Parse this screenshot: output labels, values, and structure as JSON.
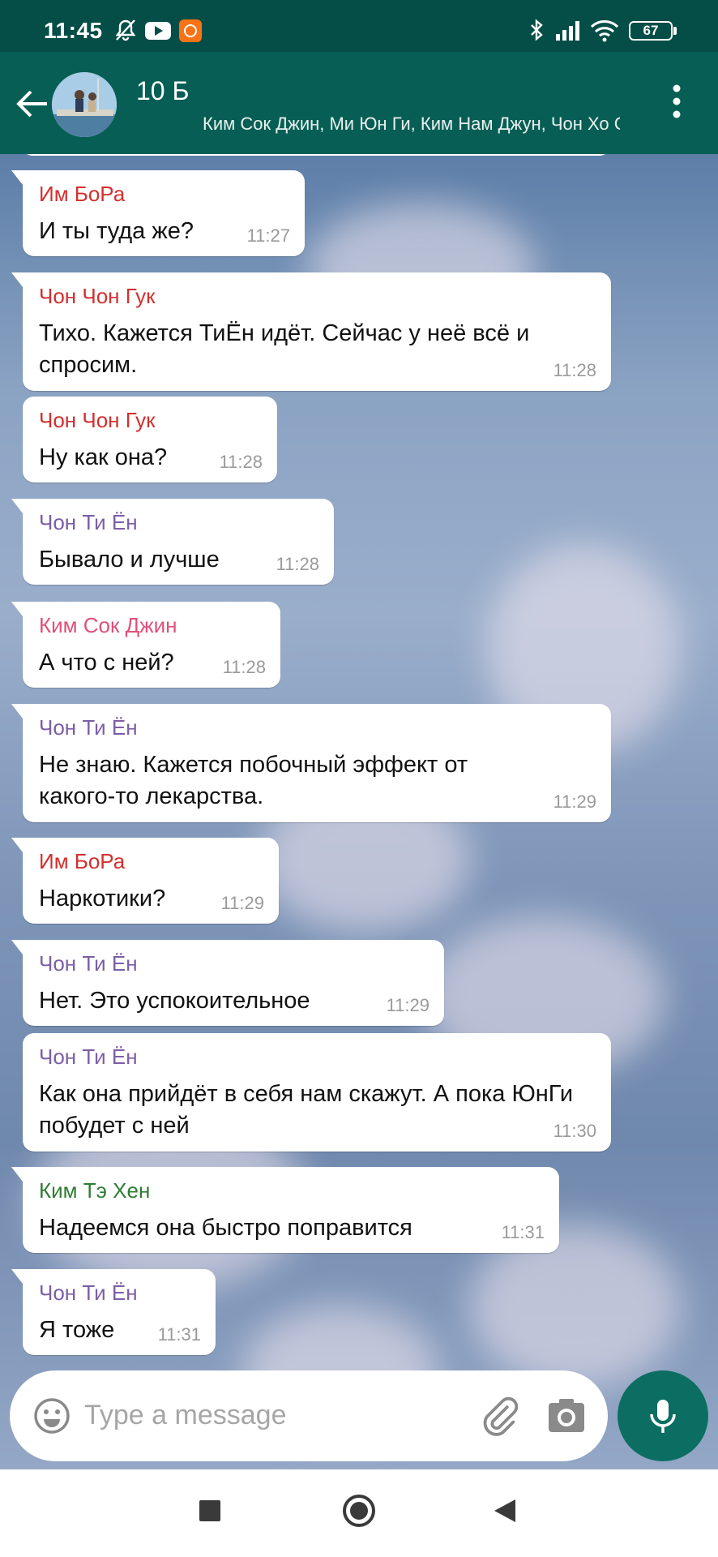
{
  "status_bar": {
    "time": "11:45",
    "battery": "67"
  },
  "chat_header": {
    "title": "10 Б",
    "members": "Ким Сок Джин, Ми Юн Ги, Ким Нам Джун, Чон Хо Сок"
  },
  "messages": [
    {
      "sender": "Им БоРа",
      "sender_color": "#d32f2f",
      "text": "И ты туда же?",
      "time": "11:27",
      "tail": true
    },
    {
      "sender": "Чон Чон Гук",
      "sender_color": "#d32f2f",
      "text": "Тихо. Кажется ТиЁн идёт. Сейчас у неё всё и спросим.",
      "time": "11:28",
      "tail": true
    },
    {
      "sender": "Чон Чон Гук",
      "sender_color": "#d32f2f",
      "text": "Ну как она?",
      "time": "11:28",
      "tail": false
    },
    {
      "sender": "Чон Ти Ён",
      "sender_color": "#7b5ea7",
      "text": "Бывало и лучше",
      "time": "11:28",
      "tail": true
    },
    {
      "sender": "Ким Сок Джин",
      "sender_color": "#e0507a",
      "text": "А что с ней?",
      "time": "11:28",
      "tail": true
    },
    {
      "sender": "Чон Ти Ён",
      "sender_color": "#7b5ea7",
      "text": "Не знаю. Кажется побочный эффект от какого-то лекарства.",
      "time": "11:29",
      "tail": true
    },
    {
      "sender": "Им БоРа",
      "sender_color": "#d32f2f",
      "text": "Наркотики?",
      "time": "11:29",
      "tail": true
    },
    {
      "sender": "Чон Ти Ён",
      "sender_color": "#7b5ea7",
      "text": "Нет. Это успокоительное",
      "time": "11:29",
      "tail": true
    },
    {
      "sender": "Чон Ти Ён",
      "sender_color": "#7b5ea7",
      "text": "Как она прийдёт в себя нам скажут. А пока ЮнГи побудет с ней",
      "time": "11:30",
      "tail": false
    },
    {
      "sender": "Ким Тэ Хен",
      "sender_color": "#2e7d32",
      "text": "Надеемся она быстро поправится",
      "time": "11:31",
      "tail": true
    },
    {
      "sender": "Чон Ти Ён",
      "sender_color": "#7b5ea7",
      "text": "Я тоже",
      "time": "11:31",
      "tail": true
    }
  ],
  "composer": {
    "placeholder": "Type a message"
  },
  "colors": {
    "header": "#075e54",
    "status_bar": "#054e47",
    "mic_button": "#0c6e63"
  },
  "icons": [
    "bell-off-icon",
    "youtube-icon",
    "mi-app-icon",
    "bluetooth-icon",
    "signal-icon",
    "wifi-icon",
    "battery-icon",
    "back-arrow-icon",
    "more-vert-icon",
    "emoji-icon",
    "attach-icon",
    "camera-icon",
    "mic-icon",
    "nav-square-icon",
    "nav-home-icon",
    "nav-back-icon"
  ]
}
